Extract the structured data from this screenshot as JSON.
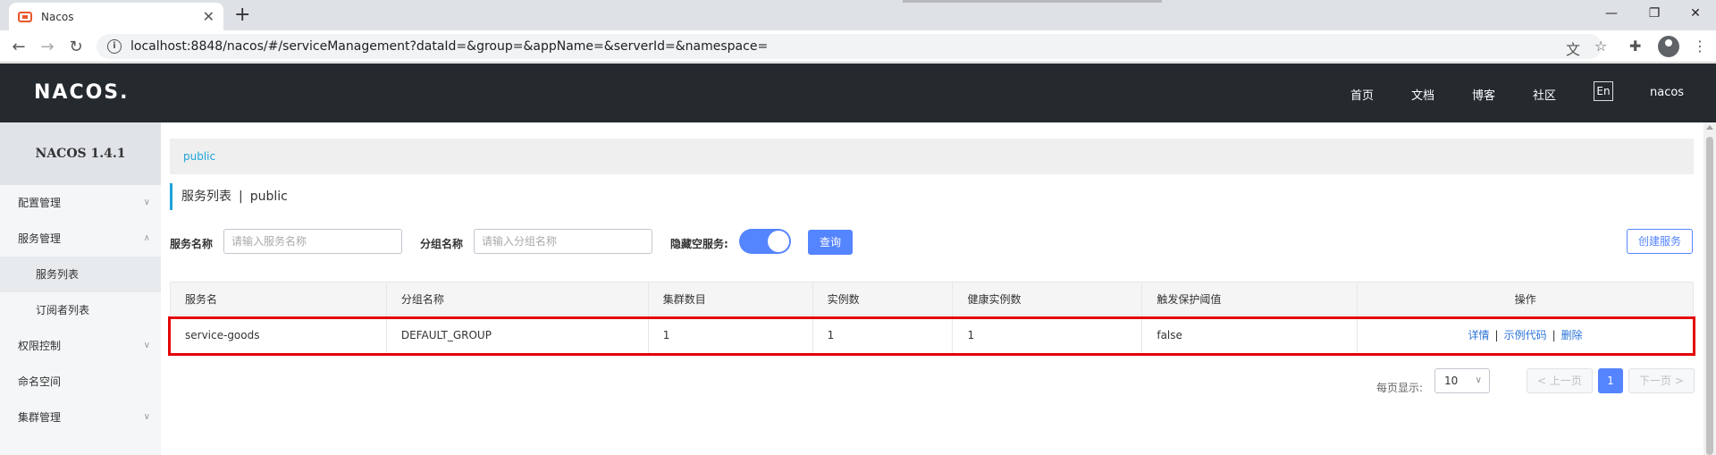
{
  "browser": {
    "tab_title": "Nacos",
    "tab_close": "✕",
    "new_tab": "+",
    "url": "localhost:8848/nacos/#/serviceManagement?dataId=&group=&appName=&serverId=&namespace=",
    "win_minimize": "—",
    "win_restore": "❐",
    "win_close": "✕"
  },
  "header": {
    "logo": "NACOS.",
    "nav": [
      "首页",
      "文档",
      "博客",
      "社区"
    ],
    "lang": "En",
    "user": "nacos"
  },
  "sidebar": {
    "title": "NACOS 1.4.1",
    "items": [
      {
        "label": "配置管理"
      },
      {
        "label": "服务管理"
      },
      {
        "label": "服务列表"
      },
      {
        "label": "订阅者列表"
      },
      {
        "label": "权限控制"
      },
      {
        "label": "命名空间"
      },
      {
        "label": "集群管理"
      }
    ]
  },
  "main": {
    "breadcrumb": "public",
    "page_title": "服务列表",
    "page_sep": "|",
    "page_namespace": "public",
    "filters": {
      "service_label": "服务名称",
      "service_placeholder": "请输入服务名称",
      "group_label": "分组名称",
      "group_placeholder": "请输入分组名称",
      "hide_empty_label": "隐藏空服务:",
      "query_button": "查询",
      "create_button": "创建服务"
    },
    "table": {
      "headers": [
        "服务名",
        "分组名称",
        "集群数目",
        "实例数",
        "健康实例数",
        "触发保护阈值",
        "操作"
      ],
      "rows": [
        {
          "service": "service-goods",
          "group": "DEFAULT_GROUP",
          "clusters": "1",
          "instances": "1",
          "healthy": "1",
          "threshold": "false",
          "op_detail": "详情",
          "op_sample": "示例代码",
          "op_delete": "删除"
        }
      ]
    },
    "pager": {
      "per_page_label": "每页显示:",
      "per_page_value": "10",
      "prev": "上一页",
      "current": "1",
      "next": "下一页"
    }
  },
  "colors": {
    "header_bg": "#252a2f",
    "accent": "#5584ff",
    "link": "#1ea3d8",
    "highlight": "#e30000"
  }
}
